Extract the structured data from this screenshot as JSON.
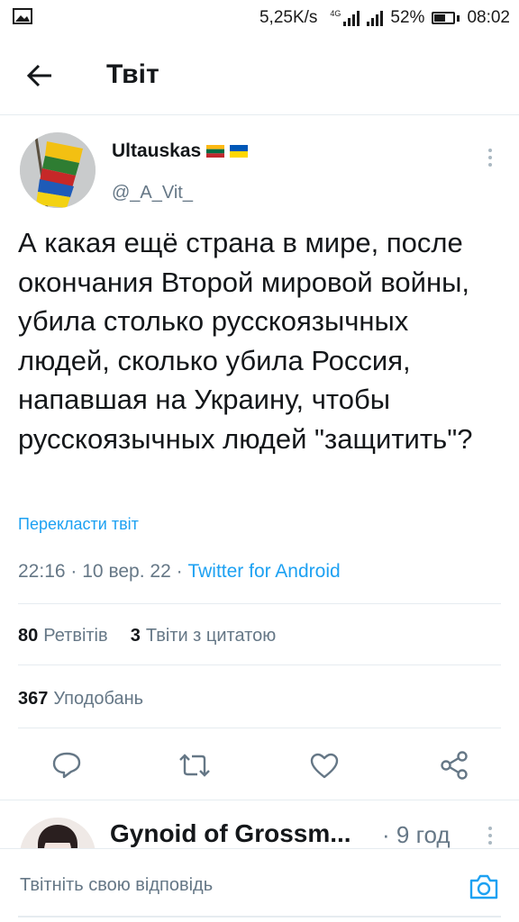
{
  "status_bar": {
    "network_speed": "5,25K/s",
    "network_type": "4G",
    "battery": "52%",
    "battery_level": 0.52,
    "time": "08:02"
  },
  "header": {
    "back_icon": "arrow-left-icon",
    "title": "Твіт"
  },
  "tweet": {
    "author_name": "Ultauskas",
    "author_flags": [
      "lithuania-flag",
      "ukraine-flag"
    ],
    "author_handle": "@_A_Vit_",
    "text": "А какая ещё страна в мире, после окончания Второй мировой войны, убила столько русскоязычных людей, сколько убила Россия, напавшая на Украину, чтобы русскоязычных людей \"защитить\"?",
    "translate_label": "Перекласти твіт",
    "time": "22:16",
    "date": "10 вер. 22",
    "separator": "·",
    "source": "Twitter for Android",
    "retweets_count": "80",
    "retweets_label": "Ретвітів",
    "quotes_count": "3",
    "quotes_label": "Твіти з цитатою",
    "likes_count": "367",
    "likes_label": "Уподобань"
  },
  "actions": [
    {
      "name": "reply",
      "icon": "reply-icon"
    },
    {
      "name": "retweet",
      "icon": "retweet-icon"
    },
    {
      "name": "like",
      "icon": "heart-icon"
    },
    {
      "name": "share",
      "icon": "share-icon"
    }
  ],
  "reply_preview": {
    "author_name": "Gynoid of Grossm...",
    "time": "· 9 год"
  },
  "compose": {
    "placeholder": "Твітніть свою відповідь",
    "camera_icon": "camera-icon"
  },
  "colors": {
    "accent": "#1da1f2",
    "text_primary": "#14171a",
    "text_secondary": "#657786",
    "divider": "#e6ecf0"
  }
}
